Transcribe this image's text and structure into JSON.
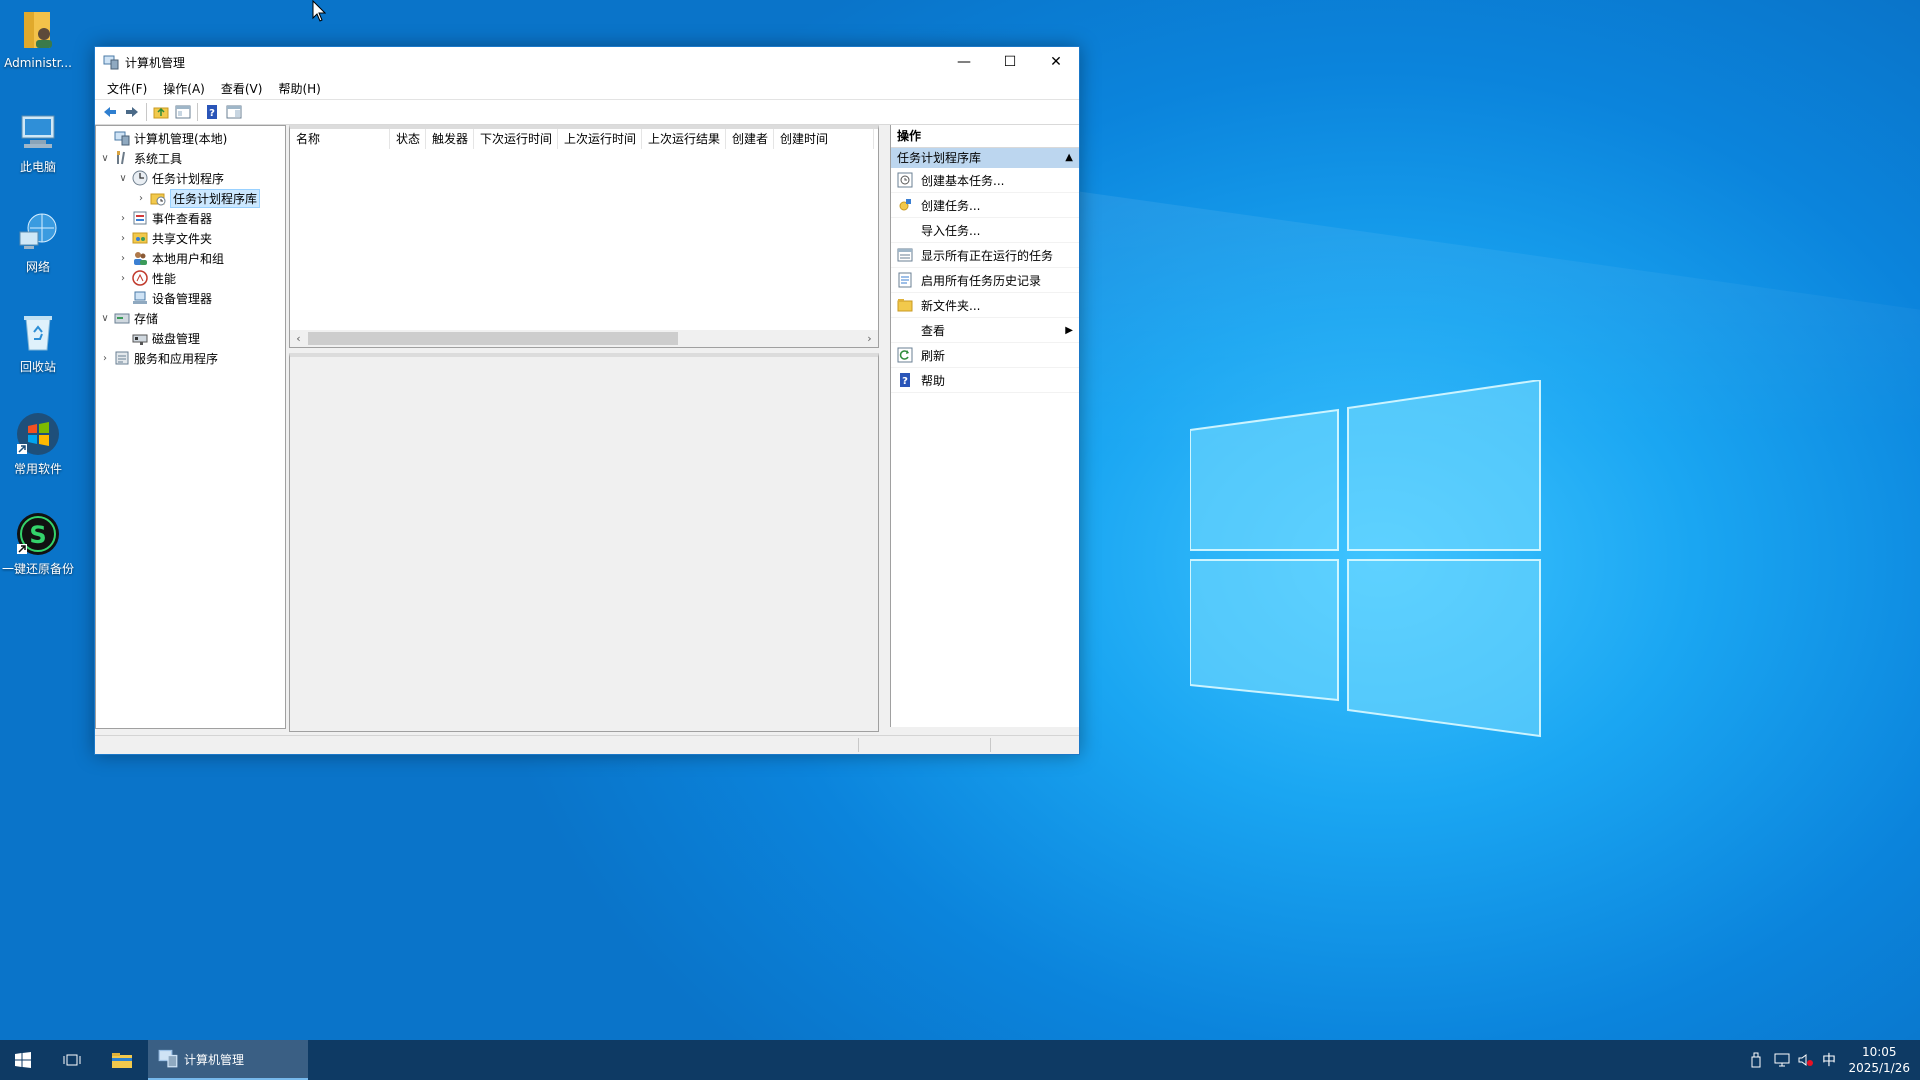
{
  "desktop": {
    "icons": [
      {
        "label": "Administr...",
        "icon": "user-folder-icon"
      },
      {
        "label": "此电脑",
        "icon": "computer-icon"
      },
      {
        "label": "网络",
        "icon": "network-icon"
      },
      {
        "label": "回收站",
        "icon": "recycle-bin-icon"
      },
      {
        "label": "常用软件",
        "icon": "windows-shortcut-icon"
      },
      {
        "label": "一键还原备份",
        "icon": "restore-s-icon"
      }
    ]
  },
  "window": {
    "title": "计算机管理",
    "controls": {
      "minimize": "—",
      "maximize": "☐",
      "close": "✕"
    },
    "menu": [
      "文件(F)",
      "操作(A)",
      "查看(V)",
      "帮助(H)"
    ],
    "toolbar": [
      "back-arrow-icon",
      "forward-arrow-icon",
      "up-folder-icon",
      "show-hide-tree-icon",
      "help-icon",
      "action-pane-icon"
    ]
  },
  "tree": {
    "items": [
      {
        "label": "计算机管理(本地)",
        "expander": "",
        "icon": "computer-management-icon"
      },
      {
        "label": "系统工具",
        "expander": "∨",
        "icon": "system-tools-icon"
      },
      {
        "label": "任务计划程序",
        "expander": "∨",
        "icon": "task-scheduler-icon"
      },
      {
        "label": "任务计划程序库",
        "expander": "›",
        "icon": "folder-clock-icon"
      },
      {
        "label": "事件查看器",
        "expander": "›",
        "icon": "event-viewer-icon"
      },
      {
        "label": "共享文件夹",
        "expander": "›",
        "icon": "shared-folder-icon"
      },
      {
        "label": "本地用户和组",
        "expander": "›",
        "icon": "users-icon"
      },
      {
        "label": "性能",
        "expander": "›",
        "icon": "performance-icon"
      },
      {
        "label": "设备管理器",
        "expander": "",
        "icon": "device-manager-icon"
      },
      {
        "label": "存储",
        "expander": "∨",
        "icon": "storage-icon"
      },
      {
        "label": "磁盘管理",
        "expander": "",
        "icon": "disk-management-icon"
      },
      {
        "label": "服务和应用程序",
        "expander": "›",
        "icon": "services-icon"
      }
    ]
  },
  "list": {
    "columns": [
      "名称",
      "状态",
      "触发器",
      "下次运行时间",
      "上次运行时间",
      "上次运行结果",
      "创建者",
      "创建时间"
    ],
    "scroll_left": "‹",
    "scroll_right": "›"
  },
  "actions": {
    "header": "操作",
    "section": "任务计划程序库",
    "section_toggle": "▲",
    "items": [
      {
        "label": "创建基本任务...",
        "icon": "create-basic-task-icon"
      },
      {
        "label": "创建任务...",
        "icon": "create-task-icon"
      },
      {
        "label": "导入任务...",
        "icon": ""
      },
      {
        "label": "显示所有正在运行的任务",
        "icon": "running-tasks-icon"
      },
      {
        "label": "启用所有任务历史记录",
        "icon": "history-icon"
      },
      {
        "label": "新文件夹...",
        "icon": "new-folder-icon"
      },
      {
        "label": "查看",
        "icon": "",
        "submenu": "▶"
      },
      {
        "label": "刷新",
        "icon": "refresh-icon"
      },
      {
        "label": "帮助",
        "icon": "help-icon"
      }
    ]
  },
  "taskbar": {
    "active_app": "计算机管理",
    "tray": {
      "ime": "中",
      "time": "10:05",
      "date": "2025/1/26"
    }
  },
  "colors": {
    "selection": "#cce8ff",
    "section_bg": "#bcd6ef",
    "taskbar": "#0e3a64",
    "wallpaper": "#0b84dc"
  }
}
